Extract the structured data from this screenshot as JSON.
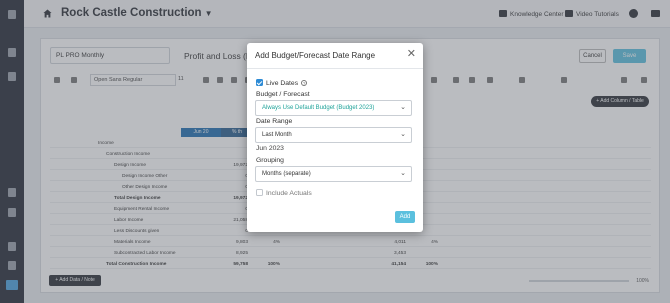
{
  "app": {
    "company": "Rock Castle Construction",
    "links": {
      "knowledge_center": "Knowledge Center",
      "video_tutorials": "Video Tutorials"
    }
  },
  "report": {
    "name": "PL PRO Monthly",
    "title": "Profit and Loss (Lin",
    "cancel_label": "Cancel",
    "save_label": "Save",
    "font_select": "Open Sans Regular",
    "font_size": "11",
    "add_column_label": "+ Add Column / Table",
    "add_row_label": "+ Add Data / Note",
    "zoom_value": "100%",
    "column_headers": [
      "Jun 20",
      "% th"
    ],
    "rows": [
      {
        "label": "Income",
        "indent": 0,
        "bold": false,
        "v1": "",
        "v2": "",
        "v3": "",
        "v4": ""
      },
      {
        "label": "Construction Income",
        "indent": 1,
        "bold": false,
        "v1": "",
        "v2": "",
        "v3": "",
        "v4": ""
      },
      {
        "label": "Design Income",
        "indent": 2,
        "bold": false,
        "v1": "19,972",
        "v2": "",
        "v3": "",
        "v4": ""
      },
      {
        "label": "Design Income Other",
        "indent": 3,
        "bold": false,
        "v1": "0",
        "v2": "",
        "v3": "",
        "v4": ""
      },
      {
        "label": "Other Design Income",
        "indent": 3,
        "bold": false,
        "v1": "0",
        "v2": "",
        "v3": "",
        "v4": ""
      },
      {
        "label": "Total Design Income",
        "indent": 2,
        "bold": true,
        "v1": "19,972",
        "v2": "",
        "v3": "",
        "v4": ""
      },
      {
        "label": "Equipment Rental Income",
        "indent": 2,
        "bold": false,
        "v1": "0",
        "v2": "",
        "v3": "",
        "v4": ""
      },
      {
        "label": "Labor Income",
        "indent": 2,
        "bold": false,
        "v1": "21,058",
        "v2": "",
        "v3": "",
        "v4": ""
      },
      {
        "label": "Less Discounts given",
        "indent": 2,
        "bold": false,
        "v1": "0",
        "v2": "",
        "v3": "",
        "v4": ""
      },
      {
        "label": "Materials Income",
        "indent": 2,
        "bold": false,
        "v1": "9,803",
        "v2": "4%",
        "v3": "4,011",
        "v4": "4%"
      },
      {
        "label": "Subcontracted Labor Income",
        "indent": 2,
        "bold": false,
        "v1": "8,925",
        "v2": "",
        "v3": "3,453",
        "v4": ""
      },
      {
        "label": "Total Construction Income",
        "indent": 1,
        "bold": true,
        "v1": "59,758",
        "v2": "100%",
        "v3": "41,154",
        "v4": "100%"
      }
    ]
  },
  "modal": {
    "title": "Add Budget/Forecast Date Range",
    "close_label": "✕",
    "live_dates": {
      "label": "Live Dates",
      "checked": true
    },
    "budget_forecast": {
      "label": "Budget / Forecast",
      "value": "Always Use Default Budget (Budget 2023)"
    },
    "date_range": {
      "label": "Date Range",
      "value": "Last Month"
    },
    "date_text": "Jun 2023",
    "grouping": {
      "label": "Grouping",
      "value": "Months (separate)"
    },
    "include_actuals": {
      "label": "Include Actuals",
      "checked": false
    },
    "add_label": "Add"
  },
  "colors": {
    "accent": "#2e8bd5",
    "teal_text": "#1fa39a",
    "button": "#5bc0de",
    "rail": "#252a36"
  }
}
